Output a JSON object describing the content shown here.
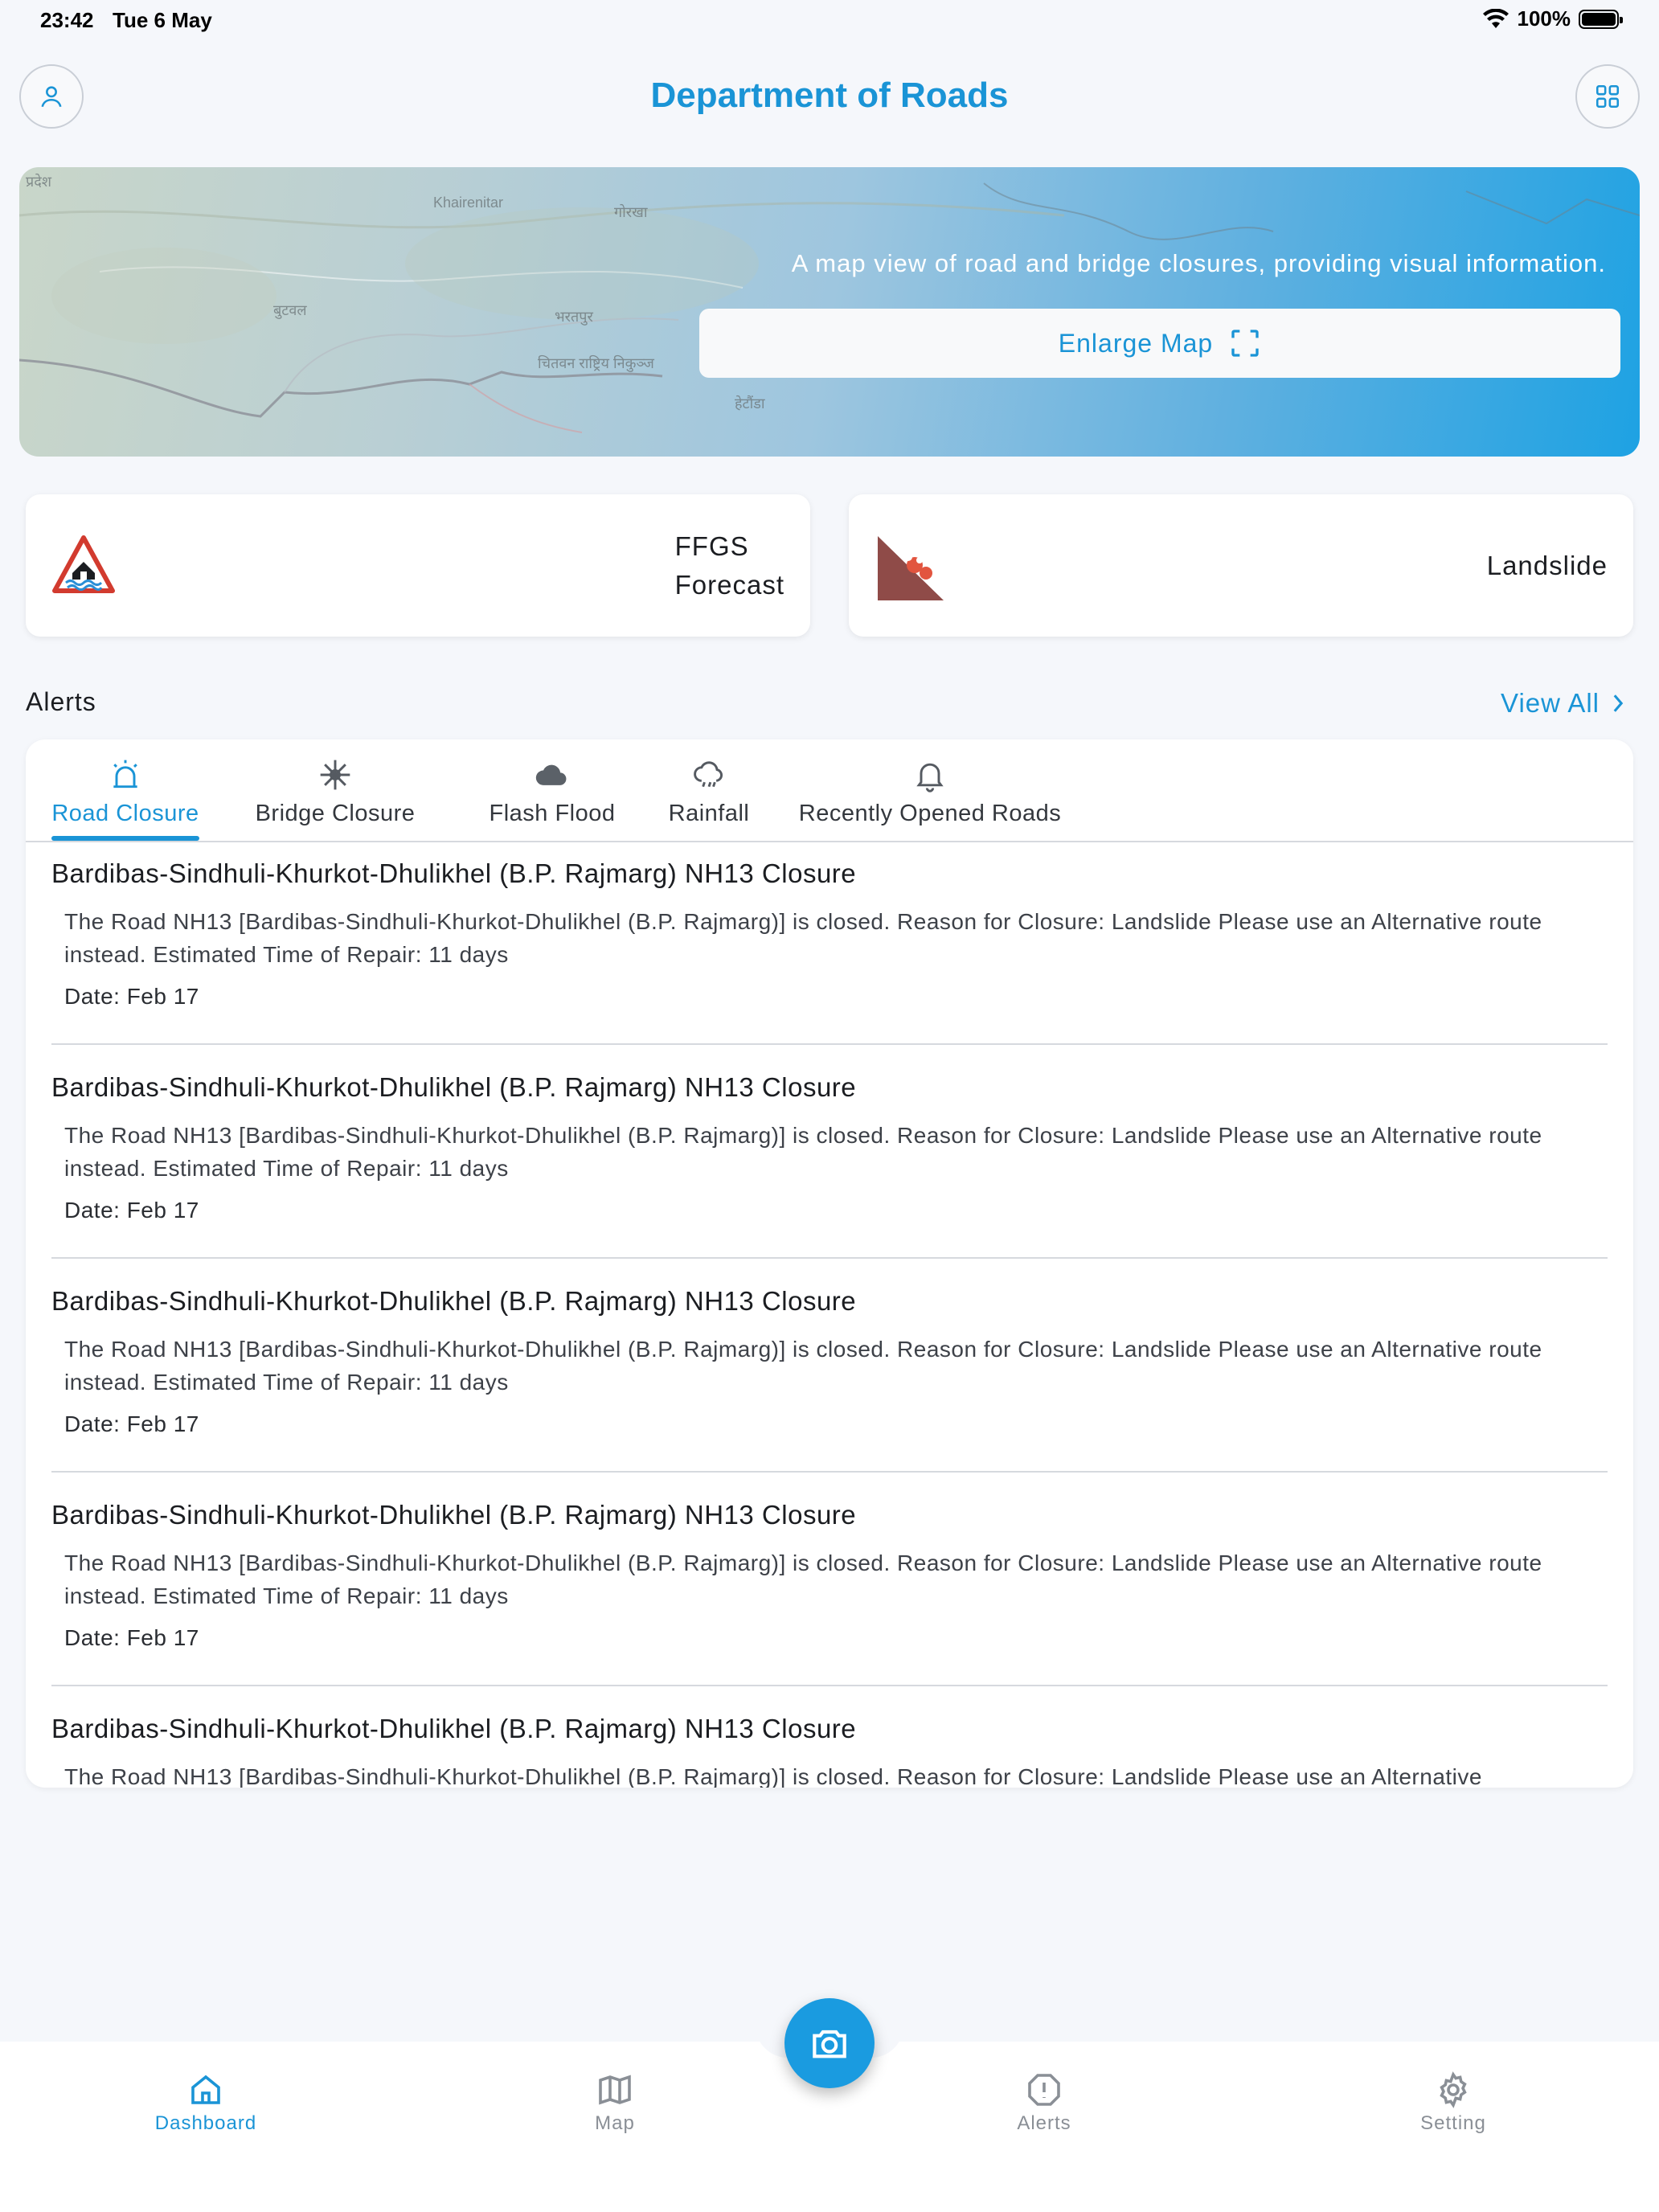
{
  "status_bar": {
    "time": "23:42",
    "date": "Tue 6 May",
    "battery": "100%"
  },
  "header": {
    "title": "Department of Roads"
  },
  "map_banner": {
    "description": "A map view of road and bridge closures, providing visual information.",
    "button_label": "Enlarge Map",
    "labels": [
      "प्रदेश",
      "Khairenitar",
      "गोरखा",
      "बुटवल",
      "भरतपुर",
      "चितवन राष्ट्रिय निकुञ्ज",
      "हेटौंडा"
    ]
  },
  "quick_cards": [
    {
      "label_line1": "FFGS",
      "label_line2": "Forecast",
      "icon": "flood-warning-icon"
    },
    {
      "label_line1": "Landslide",
      "label_line2": "",
      "icon": "landslide-icon"
    }
  ],
  "alerts": {
    "heading": "Alerts",
    "view_all": "View All",
    "tabs": [
      {
        "label": "Road Closure",
        "icon": "siren-icon",
        "active": true
      },
      {
        "label": "Bridge Closure",
        "icon": "bridge-icon",
        "active": false
      },
      {
        "label": "Flash Flood",
        "icon": "cloud-icon",
        "active": false
      },
      {
        "label": "Rainfall",
        "icon": "rain-cloud-icon",
        "active": false
      },
      {
        "label": "Recently Opened Roads",
        "icon": "bell-icon",
        "active": false
      }
    ],
    "items": [
      {
        "title": "Bardibas-Sindhuli-Khurkot-Dhulikhel (B.P. Rajmarg) NH13 Closure",
        "body": "The Road NH13 [Bardibas-Sindhuli-Khurkot-Dhulikhel (B.P. Rajmarg)] is closed. Reason for Closure: Landslide Please use an Alternative route instead. Estimated Time of Repair: 11 days",
        "date": "Date: Feb 17"
      },
      {
        "title": "Bardibas-Sindhuli-Khurkot-Dhulikhel (B.P. Rajmarg) NH13 Closure",
        "body": "The Road NH13 [Bardibas-Sindhuli-Khurkot-Dhulikhel (B.P. Rajmarg)] is closed. Reason for Closure: Landslide Please use an Alternative route instead. Estimated Time of Repair: 11 days",
        "date": "Date: Feb 17"
      },
      {
        "title": "Bardibas-Sindhuli-Khurkot-Dhulikhel (B.P. Rajmarg) NH13 Closure",
        "body": "The Road NH13 [Bardibas-Sindhuli-Khurkot-Dhulikhel (B.P. Rajmarg)] is closed. Reason for Closure: Landslide Please use an Alternative route instead. Estimated Time of Repair: 11 days",
        "date": "Date: Feb 17"
      },
      {
        "title": "Bardibas-Sindhuli-Khurkot-Dhulikhel (B.P. Rajmarg) NH13 Closure",
        "body": "The Road NH13 [Bardibas-Sindhuli-Khurkot-Dhulikhel (B.P. Rajmarg)] is closed. Reason for Closure: Landslide Please use an Alternative route instead. Estimated Time of Repair: 11 days",
        "date": "Date: Feb 17"
      },
      {
        "title": "Bardibas-Sindhuli-Khurkot-Dhulikhel (B.P. Rajmarg) NH13 Closure",
        "body": "The Road NH13 [Bardibas-Sindhuli-Khurkot-Dhulikhel (B.P. Rajmarg)] is closed. Reason for Closure: Landslide Please use an Alternative",
        "date": ""
      }
    ]
  },
  "bottom_nav": [
    {
      "label": "Dashboard",
      "icon": "home-icon",
      "active": true
    },
    {
      "label": "Map",
      "icon": "map-icon",
      "active": false
    },
    {
      "label": "Alerts",
      "icon": "alert-circle-icon",
      "active": false
    },
    {
      "label": "Setting",
      "icon": "gear-icon",
      "active": false
    }
  ],
  "colors": {
    "accent": "#1a94d6",
    "background": "#f5f7fb",
    "muted": "#8a8f96"
  }
}
